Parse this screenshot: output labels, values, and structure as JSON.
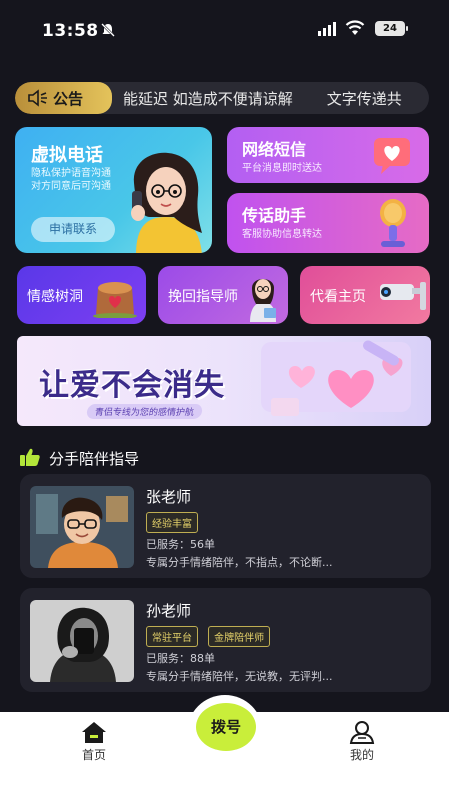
{
  "status_bar": {
    "time": "13:58",
    "battery": "24"
  },
  "notice": {
    "badge_label": "公告",
    "text_1": "能延迟 如造成不便请谅解",
    "text_2": "文字传递共"
  },
  "cards": {
    "virtual_call": {
      "title": "虚拟电话",
      "sub_1": "隐私保护语音沟通",
      "sub_2": "对方同意后可沟通",
      "button": "申请联系"
    },
    "sms": {
      "title": "网络短信",
      "sub": "平台消息即时送达"
    },
    "helper": {
      "title": "传话助手",
      "sub": "客服协助信息转达"
    },
    "tree_hole": {
      "title": "情感树洞"
    },
    "guide": {
      "title": "挽回指导师"
    },
    "home_view": {
      "title": "代看主页"
    }
  },
  "banner": {
    "slogan": "让爱不会消失",
    "tagline": "青侣专线为您的感情护航"
  },
  "section": {
    "title": "分手陪伴指导"
  },
  "mentors": [
    {
      "name": "张老师",
      "tags": [
        "经验丰富"
      ],
      "served": "已服务：56单",
      "desc": "专属分手情绪陪伴，不指点，不论断..."
    },
    {
      "name": "孙老师",
      "tags": [
        "常驻平台",
        "金牌陪伴师"
      ],
      "served": "已服务：88单",
      "desc": "专属分手情绪陪伴，无说教，无评判..."
    }
  ],
  "tabbar": {
    "home": "首页",
    "dial": "拨号",
    "mine": "我的"
  },
  "colors": {
    "background": "#15151d",
    "accent_dial": "#c9ee3a",
    "notice_badge": "#d9b64e"
  }
}
